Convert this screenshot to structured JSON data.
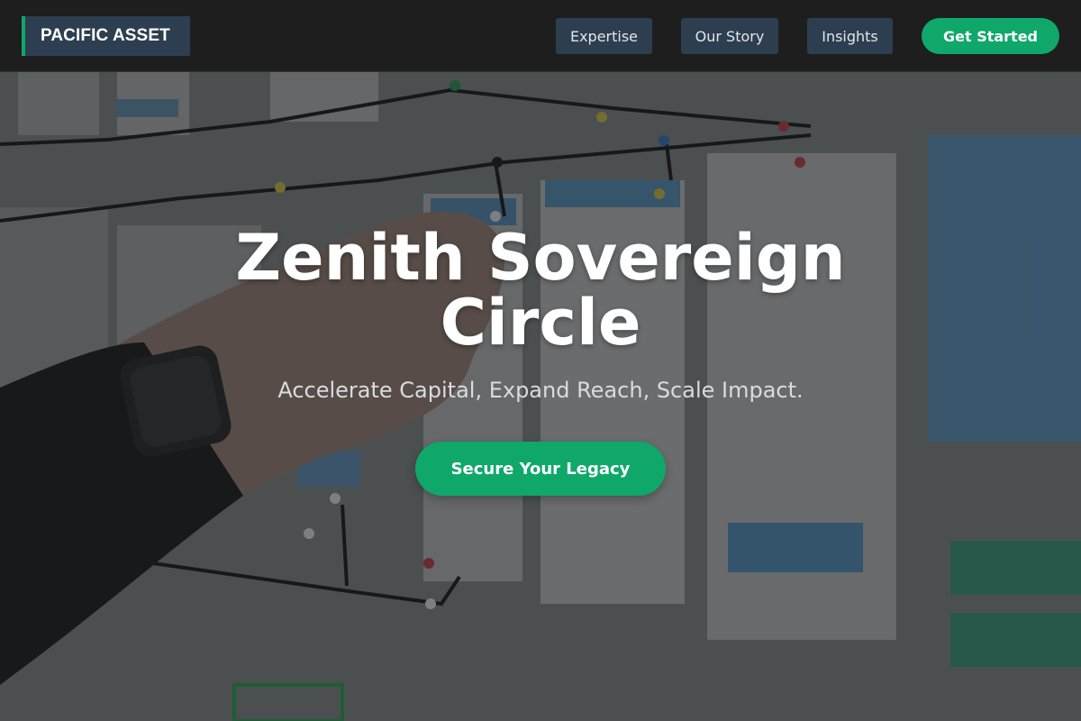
{
  "navbar": {
    "brand": "PACIFIC ASSET",
    "links": [
      {
        "label": "Expertise"
      },
      {
        "label": "Our Story"
      },
      {
        "label": "Insights"
      }
    ],
    "cta_label": "Get Started"
  },
  "hero": {
    "title_line1": "Zenith Sovereign",
    "title_line2": "Circle",
    "subtitle": "Accelerate Capital, Expand Reach, Scale Impact.",
    "cta_label": "Secure Your Legacy",
    "background_image": "hand pinning wireframe sketches on wall"
  },
  "colors": {
    "navbar_bg": "#1e1e1e",
    "button_bg": "#2c3e50",
    "accent": "#0fa86a",
    "title_text": "#ffffff"
  }
}
